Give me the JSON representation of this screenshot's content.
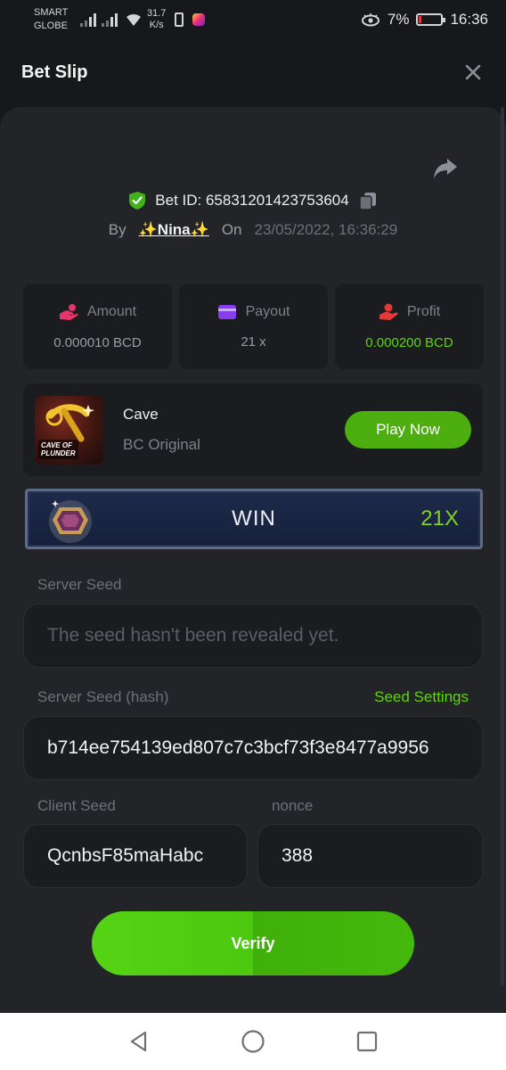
{
  "status_bar": {
    "carrier_line1": "SMART",
    "carrier_line2": "GLOBE",
    "speed_value": "31.7",
    "speed_unit": "K/s",
    "battery_percent": "7%",
    "time": "16:36"
  },
  "header": {
    "title": "Bet Slip"
  },
  "bet": {
    "id_label": "Bet ID: 65831201423753604",
    "by_label": "By",
    "user": "✨Nina✨",
    "on_label": "On",
    "date": "23/05/2022, 16:36:29"
  },
  "stats": [
    {
      "label": "Amount",
      "value": "0.000010 BCD",
      "icon": "hand-coins-icon",
      "color": "#e8336d"
    },
    {
      "label": "Payout",
      "value": "21 x",
      "icon": "wallet-card-icon",
      "color": "#8a3cf0"
    },
    {
      "label": "Profit",
      "value": "0.000200 BCD",
      "icon": "profit-hand-icon",
      "color": "#e53935"
    }
  ],
  "game": {
    "thumb_text_line1": "CAVE OF",
    "thumb_text_line2": "PLUNDER",
    "name": "Cave",
    "provider": "BC Original",
    "play_label": "Play Now"
  },
  "result": {
    "label": "WIN",
    "multiplier": "21X"
  },
  "seeds": {
    "server_seed_label": "Server Seed",
    "server_seed_value": "The seed hasn't been revealed yet.",
    "server_hash_label": "Server Seed (hash)",
    "seed_settings_label": "Seed Settings",
    "server_hash_value": "b714ee754139ed807c7c3bcf73f3e8477a9956",
    "client_seed_label": "Client Seed",
    "client_seed_value": "QcnbsF85maHabc",
    "nonce_label": "nonce",
    "nonce_value": "388"
  },
  "verify_label": "Verify",
  "colors": {
    "accent_green": "#5ed40b",
    "button_green": "#4caf0f",
    "sheet_bg": "#232428"
  }
}
